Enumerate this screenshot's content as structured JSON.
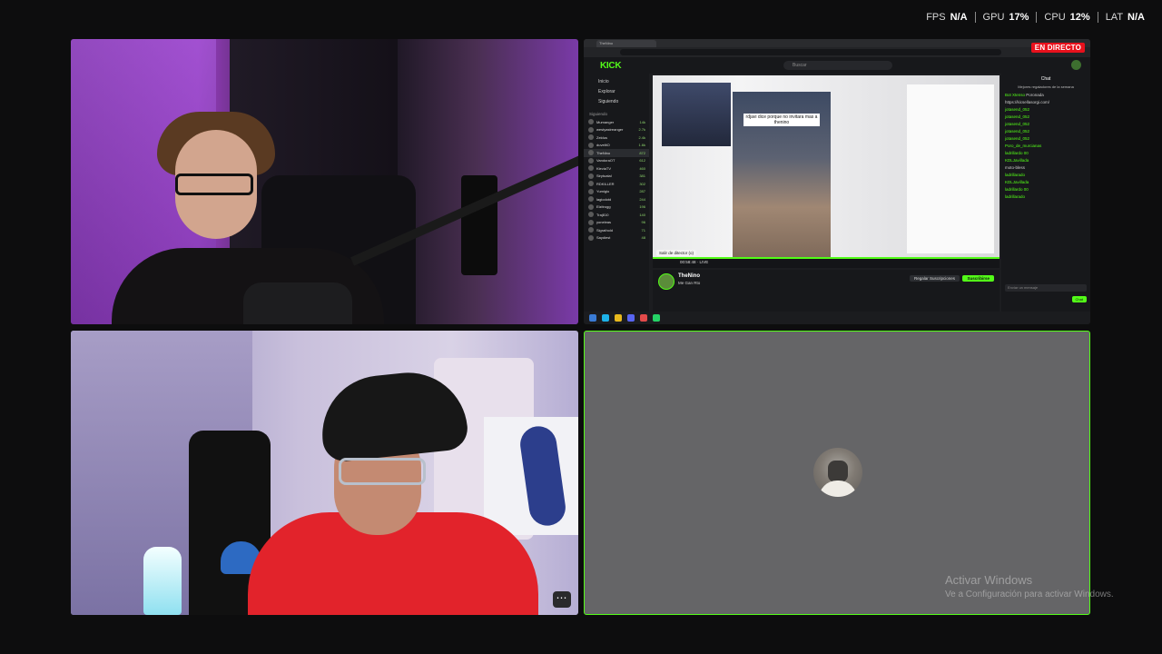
{
  "overlay": {
    "fps_label": "FPS",
    "fps_value": "N/A",
    "gpu_label": "GPU",
    "gpu_value": "17%",
    "cpu_label": "CPU",
    "cpu_value": "12%",
    "lat_label": "LAT",
    "lat_value": "N/A"
  },
  "screen_share": {
    "live_badge": "EN DIRECTO",
    "kick": {
      "logo": "KICK",
      "search_placeholder": "Buscar",
      "nav": [
        "Inicio",
        "Explorar",
        "Siguiendo"
      ],
      "following_label": "Siguiendo",
      "channels": [
        {
          "name": "Mumanger",
          "viewers": "14k"
        },
        {
          "name": "westyastreanger",
          "viewers": "2.7k"
        },
        {
          "name": "Zeldus",
          "viewers": "2.4k"
        },
        {
          "name": "duvelitO",
          "viewers": "1.6k"
        },
        {
          "name": "TheNino",
          "viewers": "872"
        },
        {
          "name": "VandoraOT",
          "viewers": "612"
        },
        {
          "name": "KleviaTV",
          "viewers": "460"
        },
        {
          "name": "Sirytuatal",
          "viewers": "381"
        },
        {
          "name": "RDKILLER",
          "viewers": "302"
        },
        {
          "name": "Yumigio",
          "viewers": "287"
        },
        {
          "name": "lagiodotd",
          "viewers": "244"
        },
        {
          "name": "Elzitrogg",
          "viewers": "196"
        },
        {
          "name": "Traj810",
          "viewers": "140"
        },
        {
          "name": "yoneleas",
          "viewers": "96"
        },
        {
          "name": "Sigrathold",
          "viewers": "71"
        },
        {
          "name": "Saydiest",
          "viewers": "48"
        }
      ],
      "caption": "rdjavi dice porque no invitara mas a thenino",
      "tooltip": "Salir de ditector (o)",
      "time": "00:58:48 · LIVE",
      "streamer_name": "TheNino",
      "stream_title": "Me Gan Rto",
      "gift_button": "Regalar Suscripciones",
      "subscribe_button": "Suscribirse",
      "chat_title": "Chat",
      "chat_subtitle": "Mejores regaladores de la semana",
      "chat_messages": [
        {
          "user": "Bot Xtenso",
          "text": "Poronada"
        },
        {
          "user": "",
          "text": "https://kicsellasorgi.com/"
        },
        {
          "user": "jotasend_052",
          "text": ""
        },
        {
          "user": "jotasend_052",
          "text": ""
        },
        {
          "user": "jotasend_052",
          "text": ""
        },
        {
          "user": "jotasend_052",
          "text": ""
        },
        {
          "user": "jotasend_052",
          "text": ""
        },
        {
          "user": "Poro_de_murcianas",
          "text": ""
        },
        {
          "user": "ladrillardo 00",
          "text": ""
        },
        {
          "user": "KDLJavillada",
          "text": ""
        },
        {
          "user": "",
          "text": "moto-bless"
        },
        {
          "user": "ladrillarado",
          "text": ""
        },
        {
          "user": "KDLJavillada",
          "text": ""
        },
        {
          "user": "ladrillardo 00",
          "text": ""
        },
        {
          "user": "ladrillarado",
          "text": ""
        }
      ],
      "chat_input_placeholder": "Enviar un mensaje",
      "chat_send": "Chat"
    }
  },
  "windows_watermark": {
    "line1": "Activar Windows",
    "line2": "Ve a Configuración para activar Windows."
  },
  "tile_menu": "⋯"
}
